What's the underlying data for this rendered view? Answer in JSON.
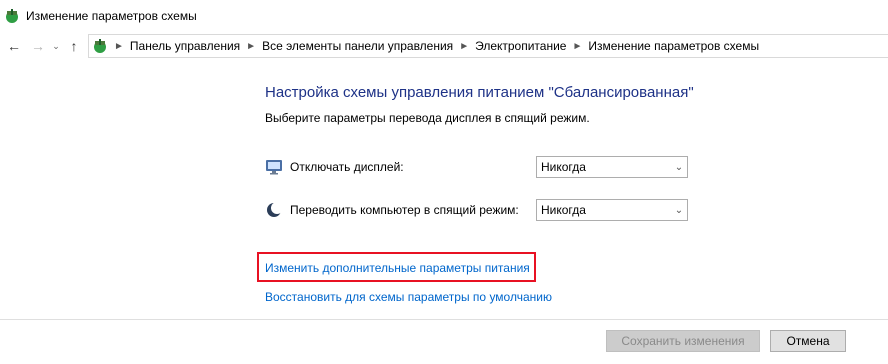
{
  "window": {
    "title": "Изменение параметров схемы"
  },
  "nav": {
    "breadcrumbs": [
      "Панель управления",
      "Все элементы панели управления",
      "Электропитание",
      "Изменение параметров схемы"
    ]
  },
  "main": {
    "heading": "Настройка схемы управления питанием \"Сбалансированная\"",
    "subheading": "Выберите параметры перевода дисплея в спящий режим.",
    "settings": [
      {
        "label": "Отключать дисплей:",
        "value": "Никогда",
        "icon": "monitor-icon"
      },
      {
        "label": "Переводить компьютер в спящий режим:",
        "value": "Никогда",
        "icon": "moon-icon"
      }
    ],
    "link_advanced": "Изменить дополнительные параметры питания",
    "link_restore": "Восстановить для схемы параметры по умолчанию"
  },
  "footer": {
    "save_label": "Сохранить изменения",
    "cancel_label": "Отмена"
  },
  "colors": {
    "heading": "#1e3287",
    "link": "#0066cc",
    "highlight": "#e81123"
  }
}
